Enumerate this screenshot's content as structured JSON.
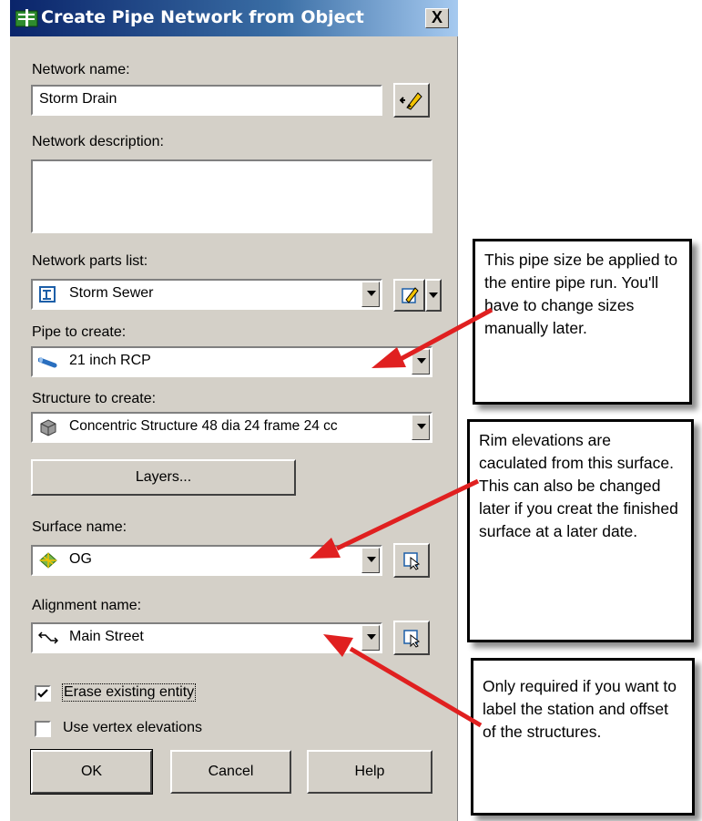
{
  "dialog": {
    "title": "Create Pipe Network from Object",
    "close_label": "X",
    "network_name": {
      "label": "Network name:",
      "value": "Storm Drain"
    },
    "network_description": {
      "label": "Network description:",
      "value": ""
    },
    "parts_list": {
      "label": "Network parts list:",
      "value": "Storm Sewer",
      "icon": "parts-list-icon"
    },
    "pipe": {
      "label": "Pipe to create:",
      "value": "21 inch RCP",
      "icon": "pipe-icon"
    },
    "structure": {
      "label": "Structure to create:",
      "value": "Concentric Structure 48 dia 24 frame 24 cc",
      "icon": "structure-icon"
    },
    "layers_button": "Layers...",
    "surface": {
      "label": "Surface name:",
      "value": "OG",
      "icon": "surface-icon"
    },
    "alignment": {
      "label": "Alignment name:",
      "value": "Main Street",
      "icon": "alignment-icon"
    },
    "erase_existing": {
      "label": "Erase existing entity",
      "checked": true
    },
    "use_vertex": {
      "label": "Use vertex elevations",
      "checked": false
    },
    "buttons": {
      "ok": "OK",
      "cancel": "Cancel",
      "help": "Help"
    }
  },
  "callouts": [
    {
      "text": "This pipe size be applied to the entire pipe run.  You'll have to change sizes manually later."
    },
    {
      "text": "Rim elevations are caculated from this surface.  This can also be changed later if you creat the finished surface at a later date."
    },
    {
      "text": "Only required if you want to label the station and offset of the structures."
    }
  ],
  "colors": {
    "arrow": "#e02020",
    "dialog_face": "#d4d0c8",
    "titlebar": "#0a246a"
  }
}
